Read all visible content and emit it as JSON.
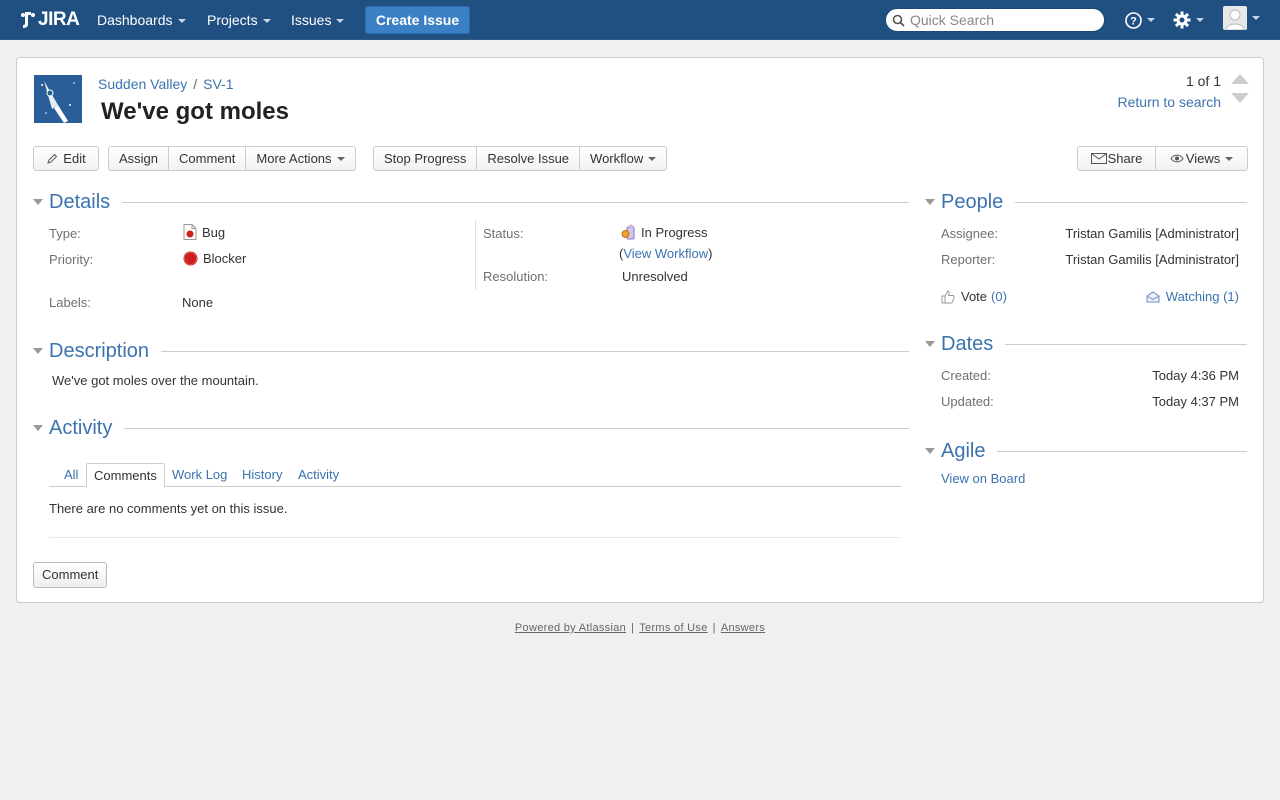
{
  "header": {
    "logo_text": "JIRA",
    "nav": [
      "Dashboards",
      "Projects",
      "Issues"
    ],
    "create_label": "Create Issue",
    "search_placeholder": "Quick Search"
  },
  "issue": {
    "project": "Sudden Valley",
    "key": "SV-1",
    "title": "We've got moles",
    "pager_count": "1 of 1",
    "return_label": "Return to search"
  },
  "toolbar": {
    "edit": "Edit",
    "assign": "Assign",
    "comment": "Comment",
    "more_actions": "More Actions",
    "stop_progress": "Stop Progress",
    "resolve_issue": "Resolve Issue",
    "workflow": "Workflow",
    "share": "Share",
    "views": "Views"
  },
  "details": {
    "heading": "Details",
    "type_label": "Type:",
    "type_value": "Bug",
    "priority_label": "Priority:",
    "priority_value": "Blocker",
    "labels_label": "Labels:",
    "labels_value": "None",
    "status_label": "Status:",
    "status_value": "In Progress",
    "view_workflow_open": "(",
    "view_workflow": "View Workflow",
    "view_workflow_close": ")",
    "resolution_label": "Resolution:",
    "resolution_value": "Unresolved"
  },
  "description": {
    "heading": "Description",
    "text": "We've got moles over the mountain."
  },
  "activity": {
    "heading": "Activity",
    "tabs": [
      "All",
      "Comments",
      "Work Log",
      "History",
      "Activity"
    ],
    "active_tab": "Comments",
    "empty_text": "There are no comments yet on this issue.",
    "comment_button": "Comment"
  },
  "people": {
    "heading": "People",
    "assignee_label": "Assignee:",
    "assignee": "Tristan Gamilis [Administrator]",
    "reporter_label": "Reporter:",
    "reporter": "Tristan Gamilis [Administrator]",
    "vote_label": "Vote",
    "vote_count": "(0)",
    "watching_label": "Watching (1)"
  },
  "dates": {
    "heading": "Dates",
    "created_label": "Created:",
    "created": "Today 4:36 PM",
    "updated_label": "Updated:",
    "updated": "Today 4:37 PM"
  },
  "agile": {
    "heading": "Agile",
    "link": "View on Board"
  },
  "footer": {
    "powered": "Powered by Atlassian",
    "terms": "Terms of Use",
    "answers": "Answers",
    "separator": "|"
  },
  "colors": {
    "header_bg": "#205081",
    "link": "#3b73af",
    "create_button": "#3b7fc4",
    "blocker": "#cc1f1f"
  },
  "icons": {
    "search": "search-icon",
    "help": "help-icon",
    "settings": "gear-icon",
    "user": "user-avatar-icon",
    "bug": "bug-icon",
    "blocker": "blocker-icon",
    "in_progress": "in-progress-icon",
    "vote": "thumbs-up-icon",
    "watch": "eye-icon",
    "share": "envelope-icon"
  }
}
